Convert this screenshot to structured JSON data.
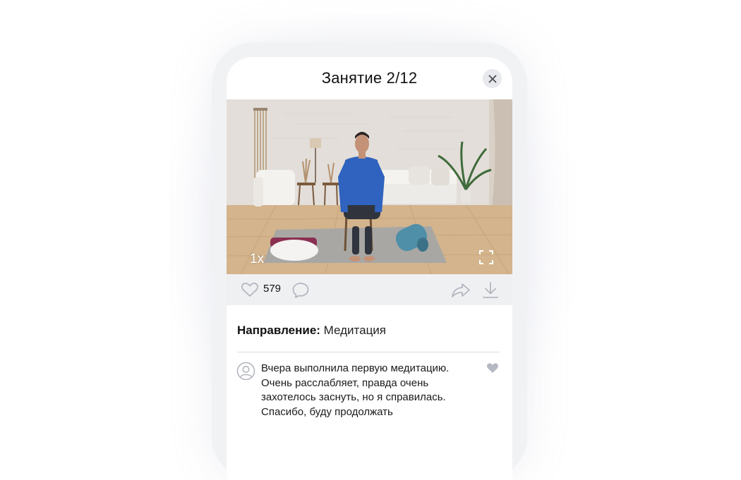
{
  "lesson": {
    "title": "Занятие 2/12"
  },
  "player": {
    "speed_label": "1x"
  },
  "actions": {
    "like_count": "579"
  },
  "details": {
    "direction_label": "Направление:",
    "direction_value": "Медитация"
  },
  "comment": {
    "lines": [
      "Вчера выполнила первую медитацию.",
      "Очень расслабляет, правда очень",
      "захотелось заснуть, но я справилась.",
      "Спасибо, буду продолжать"
    ]
  },
  "colors": {
    "icon_gray": "#b3b6bf",
    "heart_filled": "#b6b8c3",
    "close_bg": "#e8e9ec"
  },
  "icons": [
    "close-icon",
    "heart-icon",
    "comment-icon",
    "share-icon",
    "download-icon",
    "fullscreen-icon",
    "user-icon",
    "heart-filled-icon"
  ]
}
